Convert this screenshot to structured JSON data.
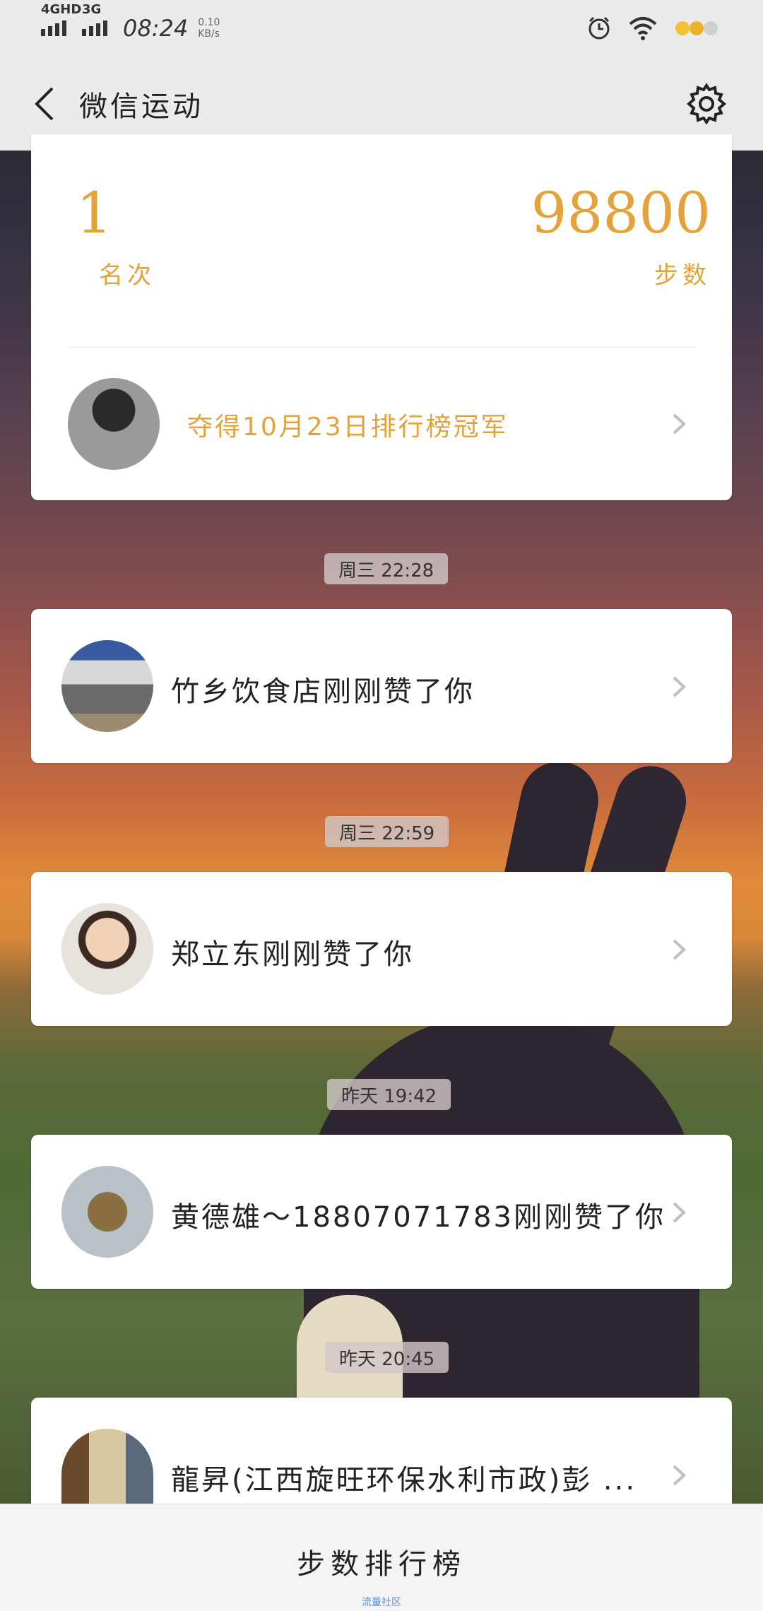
{
  "status_bar": {
    "network1": "4GHD",
    "network2": "3G",
    "time": "08:24",
    "speed_value": "0.10",
    "speed_unit": "KB/s"
  },
  "header": {
    "title": "微信运动"
  },
  "summary": {
    "rank_value": "1",
    "rank_label": "名次",
    "steps_value": "98800",
    "steps_label": "步数",
    "champion_text": "夺得10月23日排行榜冠军"
  },
  "notifications": [
    {
      "time": "周三 22:28",
      "text": "竹乡饮食店刚刚赞了你"
    },
    {
      "time": "周三 22:59",
      "text": "郑立东刚刚赞了你"
    },
    {
      "time": "昨天 19:42",
      "text": "黄德雄～18807071783刚刚赞了你"
    },
    {
      "time": "昨天 20:45",
      "text": "龍昇(江西旋旺环保水利市政)彭 ..."
    }
  ],
  "bottom": {
    "label": "步数排行榜",
    "watermark": "流量社区"
  },
  "colors": {
    "accent": "#e5a23a"
  }
}
